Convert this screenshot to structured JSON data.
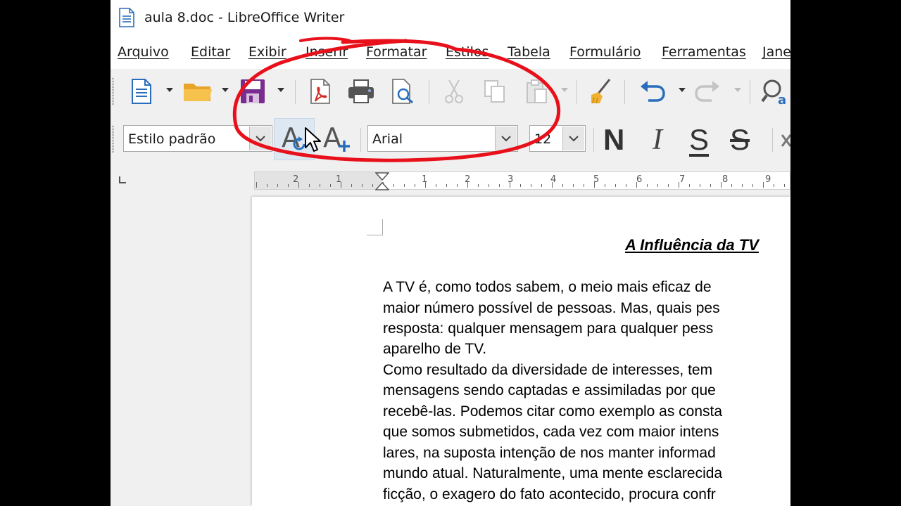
{
  "window": {
    "title": "aula 8.doc - LibreOffice Writer"
  },
  "menu": {
    "items": [
      "Arquivo",
      "Editar",
      "Exibir",
      "Inserir",
      "Formatar",
      "Estilos",
      "Tabela",
      "Formulário",
      "Ferramentas",
      "Jane"
    ]
  },
  "toolbar": {
    "paragraph_style": "Estilo padrão",
    "font_name": "Arial",
    "font_size": "12",
    "bold_glyph": "N",
    "italic_glyph": "I",
    "underline_glyph": "S",
    "strike_glyph": "S",
    "style_update_glyph": "A",
    "style_new_glyph": "A"
  },
  "ruler": {
    "numbers": [
      "2",
      "1",
      "1",
      "2",
      "3",
      "4",
      "5",
      "6",
      "7",
      "8",
      "9"
    ]
  },
  "document": {
    "title": "A Influência da TV",
    "lines": [
      "A TV é, como todos sabem, o meio mais eficaz de",
      "maior número possível de pessoas. Mas, quais pes",
      "resposta: qualquer mensagem para qualquer pess",
      "aparelho de TV.",
      "Como resultado da diversidade de interesses, tem",
      "mensagens sendo captadas e assimiladas por que",
      "recebê-las. Podemos citar como exemplo as consta",
      "que somos submetidos, cada vez com maior intens",
      "lares, na suposta intenção de nos manter informad",
      "mundo atual. Naturalmente, uma mente esclarecida",
      "ficção, o exagero do fato acontecido, procura confr"
    ]
  },
  "colors": {
    "annotation": "#e8101a",
    "accent_blue": "#2a6ebb",
    "save_purple": "#7a2c8f",
    "folder_orange": "#f0b030"
  }
}
